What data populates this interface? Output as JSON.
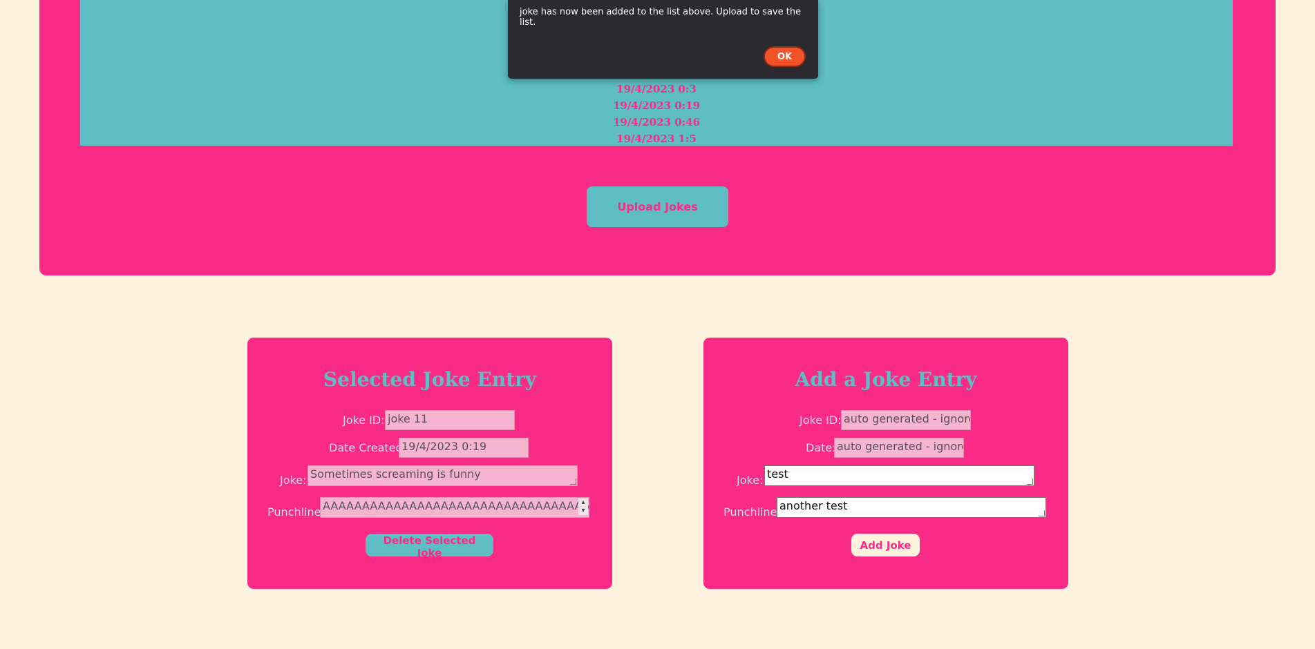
{
  "joke_list": {
    "dates": [
      "19/4/2023 0:3",
      "19/4/2023 0:19",
      "19/4/2023 0:46",
      "19/4/2023 1:5"
    ],
    "upload_label": "Upload Jokes"
  },
  "dialog": {
    "message": "joke has now been added to the list above. Upload to save the list.",
    "ok_label": "OK"
  },
  "selected_entry": {
    "title": "Selected Joke Entry",
    "id_label": "Joke ID:",
    "id_value": "joke 11",
    "date_label": "Date Created:",
    "date_value": "19/4/2023 0:19",
    "joke_label": "Joke:",
    "joke_value": "Sometimes screaming is funny",
    "punchline_label": "Punchline:",
    "punchline_value": "AAAAAAAAAAAAAAAAAAAAAAAAAAAAAAAAAAAAA",
    "delete_label": "Delete Selected Joke"
  },
  "add_entry": {
    "title": "Add a Joke Entry",
    "id_label": "Joke ID:",
    "id_value": "auto generated - ignore",
    "date_label": "Date:",
    "date_value": "auto generated - ignore",
    "joke_label": "Joke:",
    "joke_value": "test",
    "punchline_label": "Punchline:",
    "punchline_value": "another test",
    "add_label": "Add Joke"
  },
  "colors": {
    "page_bg": "#fdf3df",
    "pink": "#fa2b86",
    "teal": "#5fbdc4",
    "dialog_bg": "#2b2a2f",
    "ok_button": "#f4532a"
  }
}
